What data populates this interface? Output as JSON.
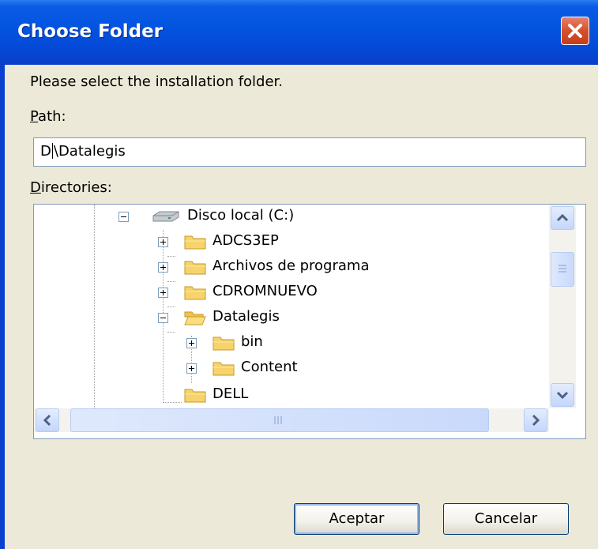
{
  "window": {
    "title": "Choose Folder"
  },
  "dialog": {
    "prompt": "Please select the installation folder.",
    "path_label_first": "P",
    "path_label_rest": "ath:",
    "path_value_start": "D",
    "path_value_end": "\\Datalegis",
    "directories_label_first": "D",
    "directories_label_rest": "irectories:"
  },
  "tree": {
    "drive": "Disco local (C:)",
    "folders": [
      "ADCS3EP",
      "Archivos de programa",
      "CDROMNUEVO",
      "Datalegis",
      "DELL"
    ],
    "subfolders": [
      "bin",
      "Content"
    ]
  },
  "buttons": {
    "ok": "Aceptar",
    "cancel": "Cancelar"
  },
  "icons": {
    "close": "close-icon",
    "drive": "hard-drive-icon",
    "folder": "folder-icon",
    "scroll_up": "arrow-up-icon",
    "scroll_down": "arrow-down-icon",
    "scroll_left": "arrow-left-icon",
    "scroll_right": "arrow-right-icon"
  },
  "colors": {
    "titlebar": "#0355e0",
    "dialog_bg": "#ece9d8",
    "close_button": "#d4502c",
    "folder": "#f7d36b"
  }
}
